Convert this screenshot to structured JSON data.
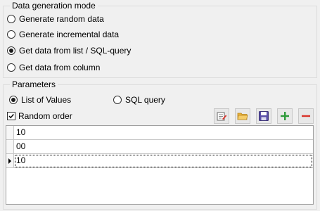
{
  "generation_mode": {
    "title": "Data generation mode",
    "options": [
      {
        "label": "Generate random data",
        "checked": false
      },
      {
        "label": "Generate incremental data",
        "checked": false
      },
      {
        "label": "Get data from list / SQL-query",
        "checked": true
      },
      {
        "label": "Get data from column",
        "checked": false
      }
    ]
  },
  "parameters": {
    "title": "Parameters",
    "source_options": [
      {
        "label": "List of Values",
        "checked": true
      },
      {
        "label": "SQL query",
        "checked": false
      }
    ],
    "random_order": {
      "label": "Random order",
      "checked": true
    },
    "toolbar": {
      "icons": [
        "edit-list-icon",
        "open-folder-icon",
        "save-icon",
        "add-icon",
        "remove-icon"
      ],
      "add_color": "#2e9a3a",
      "remove_color": "#d9342b"
    },
    "values": [
      "10",
      "00",
      "10"
    ],
    "current_row": 2
  }
}
